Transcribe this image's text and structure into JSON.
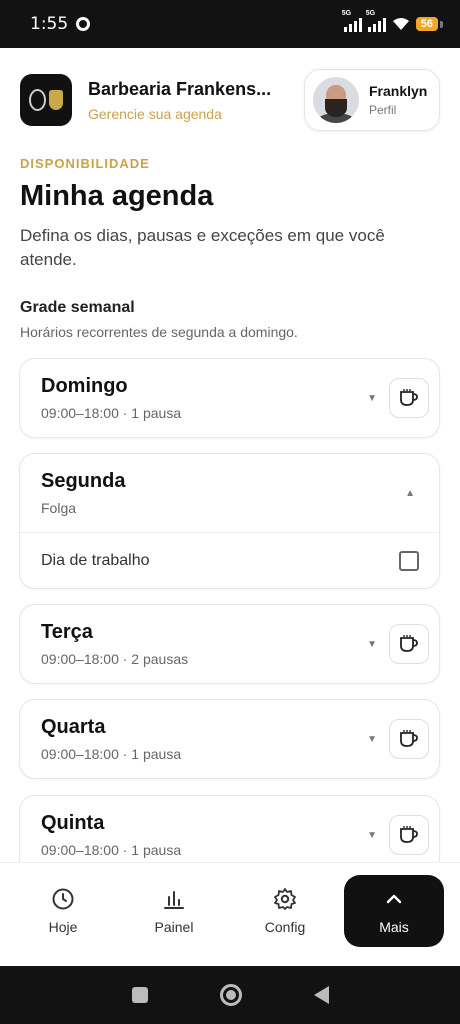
{
  "status": {
    "time": "1:55",
    "battery": "56",
    "network_tag_1": "5G",
    "network_tag_2": "5G"
  },
  "header": {
    "business_name": "Barbearia Frankens...",
    "business_sub": "Gerencie sua agenda",
    "profile_name": "Franklyn",
    "profile_label": "Perfil"
  },
  "page": {
    "eyebrow": "DISPONIBILIDADE",
    "title": "Minha agenda",
    "description": "Defina os dias, pausas e exceções em que você atende."
  },
  "weekly": {
    "title": "Grade semanal",
    "subtitle": "Horários recorrentes de segunda a domingo.",
    "days": [
      {
        "name": "Domingo",
        "summary": "09:00–18:00 · 1 pausa",
        "expanded": false
      },
      {
        "name": "Segunda",
        "summary": "Folga",
        "expanded": true,
        "work_label": "Dia de trabalho",
        "work_checked": false
      },
      {
        "name": "Terça",
        "summary": "09:00–18:00 · 2 pausas",
        "expanded": false
      },
      {
        "name": "Quarta",
        "summary": "09:00–18:00 · 1 pausa",
        "expanded": false
      },
      {
        "name": "Quinta",
        "summary": "09:00–18:00 · 1 pausa",
        "expanded": false
      }
    ]
  },
  "nav": {
    "items": [
      {
        "label": "Hoje",
        "icon": "clock-icon"
      },
      {
        "label": "Painel",
        "icon": "bar-chart-icon"
      },
      {
        "label": "Config",
        "icon": "gear-icon"
      },
      {
        "label": "Mais",
        "icon": "chevron-up-icon",
        "active": true
      }
    ]
  },
  "colors": {
    "accent": "#c9a24a",
    "active_nav": "#111111"
  }
}
